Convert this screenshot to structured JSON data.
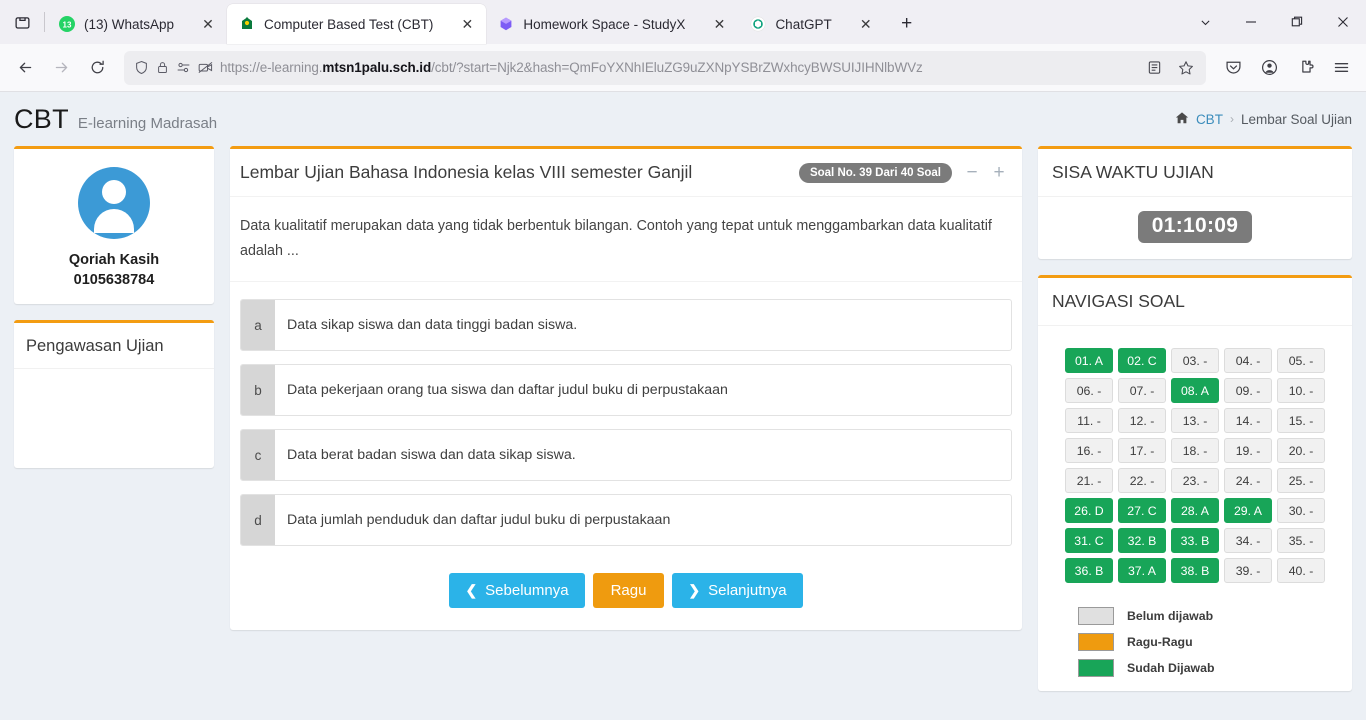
{
  "browser": {
    "tabs": [
      {
        "title": "(13) WhatsApp",
        "icon": "whatsapp-icon",
        "active": false,
        "badge": "13"
      },
      {
        "title": "Computer Based Test (CBT)",
        "icon": "madrasah-icon",
        "active": true
      },
      {
        "title": "Homework Space - StudyX",
        "icon": "studyx-icon",
        "active": false
      },
      {
        "title": "ChatGPT",
        "icon": "chatgpt-icon",
        "active": false
      }
    ],
    "url_prefix": "https://e-learning.",
    "url_domain": "mtsn1palu.sch.id",
    "url_suffix": "/cbt/?start=Njk2&hash=QmFoYXNhIEluZG9uZXNpYSBrZWxhcyBWSUIJIHNlbWVz",
    "new_tab_label": "+",
    "close_label": "✕"
  },
  "header": {
    "brand_main": "CBT",
    "brand_sub": "E-learning Madrasah",
    "breadcrumb": {
      "home": "CBT",
      "separator": "›",
      "current": "Lembar Soal Ujian"
    }
  },
  "profile": {
    "name": "Qoriah Kasih",
    "id": "0105638784"
  },
  "supervision": {
    "title": "Pengawasan Ujian"
  },
  "exam": {
    "title": "Lembar Ujian Bahasa Indonesia kelas VIII semester Ganjil",
    "badge": "Soal No. 39 Dari 40 Soal",
    "zoom_out": "−",
    "zoom_in": "+",
    "question": "Data kualitatif merupakan data yang tidak berbentuk bilangan. Contoh yang tepat untuk menggambarkan data kualitatif adalah ...",
    "options": [
      {
        "letter": "a",
        "text": "Data sikap siswa dan data tinggi badan siswa."
      },
      {
        "letter": "b",
        "text": "Data pekerjaan orang tua siswa dan daftar judul buku di perpustakaan"
      },
      {
        "letter": "c",
        "text": "Data berat badan siswa dan data sikap siswa."
      },
      {
        "letter": "d",
        "text": "Data jumlah penduduk dan daftar judul buku di perpustakaan"
      }
    ],
    "buttons": {
      "previous": "Sebelumnya",
      "doubt": "Ragu",
      "next": "Selanjutnya"
    }
  },
  "timer": {
    "title": "SISA WAKTU UJIAN",
    "value": "01:10:09"
  },
  "navigation": {
    "title": "NAVIGASI SOAL",
    "cells": [
      {
        "label": "01. A",
        "state": "answered"
      },
      {
        "label": "02. C",
        "state": "answered"
      },
      {
        "label": "03. -",
        "state": "empty"
      },
      {
        "label": "04. -",
        "state": "empty"
      },
      {
        "label": "05. -",
        "state": "empty"
      },
      {
        "label": "06. -",
        "state": "empty"
      },
      {
        "label": "07. -",
        "state": "empty"
      },
      {
        "label": "08. A",
        "state": "answered"
      },
      {
        "label": "09. -",
        "state": "empty"
      },
      {
        "label": "10. -",
        "state": "empty"
      },
      {
        "label": "11. -",
        "state": "empty"
      },
      {
        "label": "12. -",
        "state": "empty"
      },
      {
        "label": "13. -",
        "state": "empty"
      },
      {
        "label": "14. -",
        "state": "empty"
      },
      {
        "label": "15. -",
        "state": "empty"
      },
      {
        "label": "16. -",
        "state": "empty"
      },
      {
        "label": "17. -",
        "state": "empty"
      },
      {
        "label": "18. -",
        "state": "empty"
      },
      {
        "label": "19. -",
        "state": "empty"
      },
      {
        "label": "20. -",
        "state": "empty"
      },
      {
        "label": "21. -",
        "state": "empty"
      },
      {
        "label": "22. -",
        "state": "empty"
      },
      {
        "label": "23. -",
        "state": "empty"
      },
      {
        "label": "24. -",
        "state": "empty"
      },
      {
        "label": "25. -",
        "state": "empty"
      },
      {
        "label": "26. D",
        "state": "answered"
      },
      {
        "label": "27. C",
        "state": "answered"
      },
      {
        "label": "28. A",
        "state": "answered"
      },
      {
        "label": "29. A",
        "state": "answered"
      },
      {
        "label": "30. -",
        "state": "empty"
      },
      {
        "label": "31. C",
        "state": "answered"
      },
      {
        "label": "32. B",
        "state": "answered"
      },
      {
        "label": "33. B",
        "state": "answered"
      },
      {
        "label": "34. -",
        "state": "empty"
      },
      {
        "label": "35. -",
        "state": "empty"
      },
      {
        "label": "36. B",
        "state": "answered"
      },
      {
        "label": "37. A",
        "state": "answered"
      },
      {
        "label": "38. B",
        "state": "answered"
      },
      {
        "label": "39. -",
        "state": "empty"
      },
      {
        "label": "40. -",
        "state": "empty"
      }
    ],
    "legend": [
      {
        "label": "Belum dijawab",
        "color": "#e0e0e0"
      },
      {
        "label": "Ragu-Ragu",
        "color": "#ef9b0f"
      },
      {
        "label": "Sudah Dijawab",
        "color": "#18a558"
      }
    ]
  },
  "colors": {
    "accent_orange": "#f39c12",
    "answered_green": "#18a558",
    "primary_blue": "#2bb3e8",
    "page_bg": "#ecf0f5"
  }
}
